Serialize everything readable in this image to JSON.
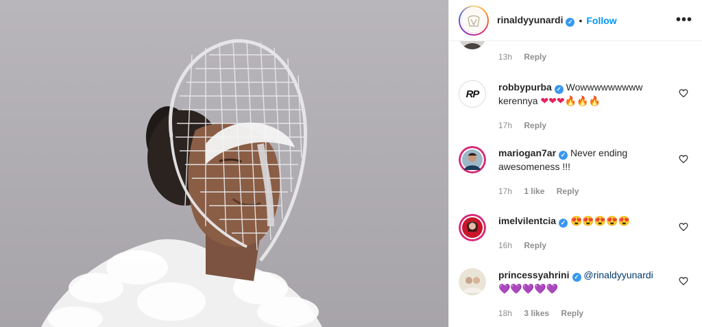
{
  "post": {
    "username": "rinaldyyunardi",
    "separator": "•",
    "follow_label": "Follow",
    "more_label": "•••"
  },
  "comments": [
    {
      "username": "",
      "time": "13h",
      "reply_label": "Reply"
    },
    {
      "username": "robbypurba",
      "avatar_text": "RP",
      "text": "Wowwwwwwwww kerennya",
      "emojis": "❤❤❤🔥🔥🔥",
      "time": "17h",
      "reply_label": "Reply"
    },
    {
      "username": "mariogan7ar",
      "text": "Never ending awesomeness !!!",
      "time": "17h",
      "likes": "1 like",
      "reply_label": "Reply"
    },
    {
      "username": "imelvilentcia",
      "emojis": "😍😍😍😍😍",
      "time": "16h",
      "reply_label": "Reply"
    },
    {
      "username": "princessyahrini",
      "mention": "@rinaldyyunardi",
      "emojis": "💜💜💜💜💜",
      "time": "18h",
      "likes": "3 likes",
      "reply_label": "Reply"
    }
  ],
  "colors": {
    "accent": "#0095f6",
    "verified": "#3897f0",
    "meta": "#8e8e8e",
    "mention": "#00376b"
  }
}
